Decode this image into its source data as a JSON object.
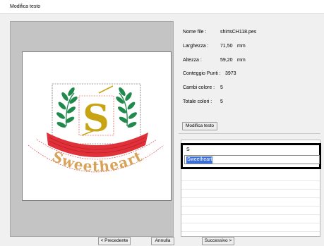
{
  "window": {
    "title": "Modifica testo"
  },
  "info": {
    "file_label": "Nome file :",
    "file_value": "shirtsCH118.pes",
    "width_label": "Larghezza :",
    "width_value": "71,50",
    "width_unit": "mm",
    "height_label": "Altezza :",
    "height_value": "59,20",
    "height_unit": "mm",
    "stitches_label": "Conteggio Punti :",
    "stitches_value": "3973",
    "color_changes_label": "Cambi colore :",
    "color_changes_value": "5",
    "total_colors_label": "Totale colori :",
    "total_colors_value": "5"
  },
  "edit_text_button": "Modifica testo",
  "text_lines": {
    "line1": "S",
    "line2": "Sweetheart"
  },
  "preview": {
    "monogram": "S",
    "arc_text": "Sweetheart"
  },
  "buttons": {
    "back": "< Precedente",
    "cancel": "Annulla",
    "next": "Successivo >"
  },
  "colors": {
    "leaf_green": "#1f8a4c",
    "gold": "#c8a312",
    "ribbon_red": "#e0303a",
    "arc_text": "#d9a259",
    "selection": "#3b6fd6"
  }
}
